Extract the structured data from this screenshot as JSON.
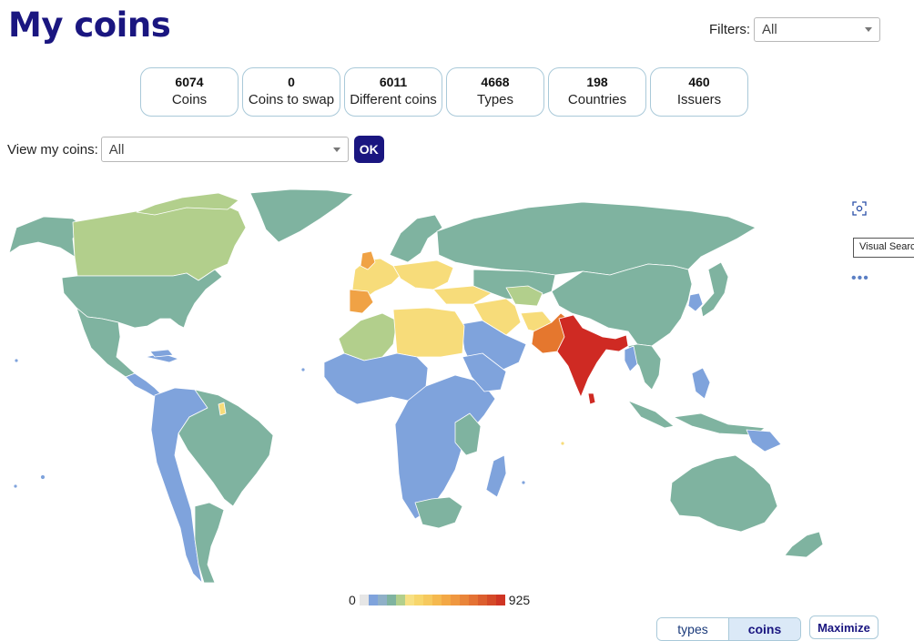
{
  "page": {
    "title": "My coins"
  },
  "filters": {
    "label": "Filters:",
    "value": "All"
  },
  "stats": [
    {
      "num": "6074",
      "label": "Coins"
    },
    {
      "num": "0",
      "label": "Coins to swap"
    },
    {
      "num": "6011",
      "label": "Different coins"
    },
    {
      "num": "4668",
      "label": "Types"
    },
    {
      "num": "198",
      "label": "Countries"
    },
    {
      "num": "460",
      "label": "Issuers"
    }
  ],
  "view": {
    "label": "View my coins:",
    "value": "All",
    "ok_label": "OK"
  },
  "map": {
    "side_icon": "visual-search-icon",
    "tooltip": "Visual Search",
    "more_icon": "more-dots-icon",
    "colors": {
      "ocean": "#ffffff",
      "teal": "#7fb3a0",
      "blue": "#7fa3dc",
      "lightgreen": "#b2cf8c",
      "yellow": "#f7dc7a",
      "orange": "#f0a245",
      "darkorange": "#e5772e",
      "red": "#cf2a23",
      "border": "#ffffff"
    }
  },
  "legend": {
    "min": "0",
    "max": "925",
    "colors": [
      "#e6e6e6",
      "#7fa3dc",
      "#8fb0c8",
      "#7fb3a0",
      "#b2cf8c",
      "#f7e083",
      "#f7d66c",
      "#f6c95e",
      "#f5b94f",
      "#f3a845",
      "#ef9740",
      "#e9853a",
      "#e47234",
      "#dc5e2e",
      "#d54a28",
      "#cf3524"
    ]
  },
  "toggle": {
    "types": "types",
    "coins": "coins"
  },
  "maximize": "Maximize"
}
